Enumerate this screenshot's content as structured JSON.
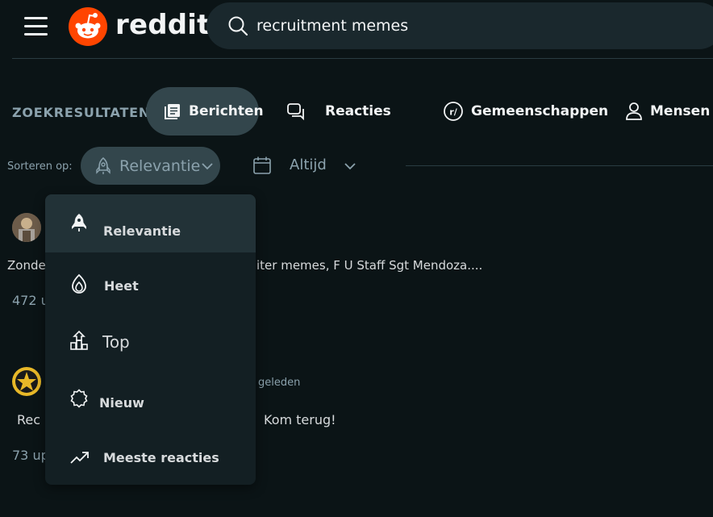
{
  "header": {
    "logo_text": "reddit",
    "search": {
      "value": "recruitment memes"
    }
  },
  "tabs": {
    "results_label": "ZOEKRESULTATEN",
    "items": [
      {
        "label": "Berichten",
        "icon": "posts-icon",
        "active": true
      },
      {
        "label": "Reacties",
        "icon": "comments-icon"
      },
      {
        "label": "Gemeenschappen",
        "icon": "community-icon"
      },
      {
        "label": "Mensen",
        "icon": "user-icon"
      }
    ]
  },
  "sort": {
    "label": "Sorteren op:",
    "selected": "Relevantie",
    "time": "Altijd"
  },
  "posts": [
    {
      "title_start": "Zonde",
      "title_end": "iter memes, F U Staff Sgt Mendoza....",
      "meta": "472 u"
    },
    {
      "time": "geleden",
      "community_start": "Rec",
      "title": "Kom terug!",
      "meta": "73 up"
    }
  ],
  "dropdown": {
    "items": [
      {
        "label": "Relevantie",
        "icon": "rocket-icon",
        "active": true
      },
      {
        "label": "Heet",
        "icon": "flame-icon"
      },
      {
        "label": "Top",
        "icon": "top-icon"
      },
      {
        "label": "Nieuw",
        "icon": "new-icon"
      },
      {
        "label": "Meeste reacties",
        "icon": "trending-icon"
      }
    ]
  },
  "colors": {
    "background": "#0b1416",
    "accent": "#ff4500",
    "pill": "#33464c",
    "menu": "#131f23"
  }
}
